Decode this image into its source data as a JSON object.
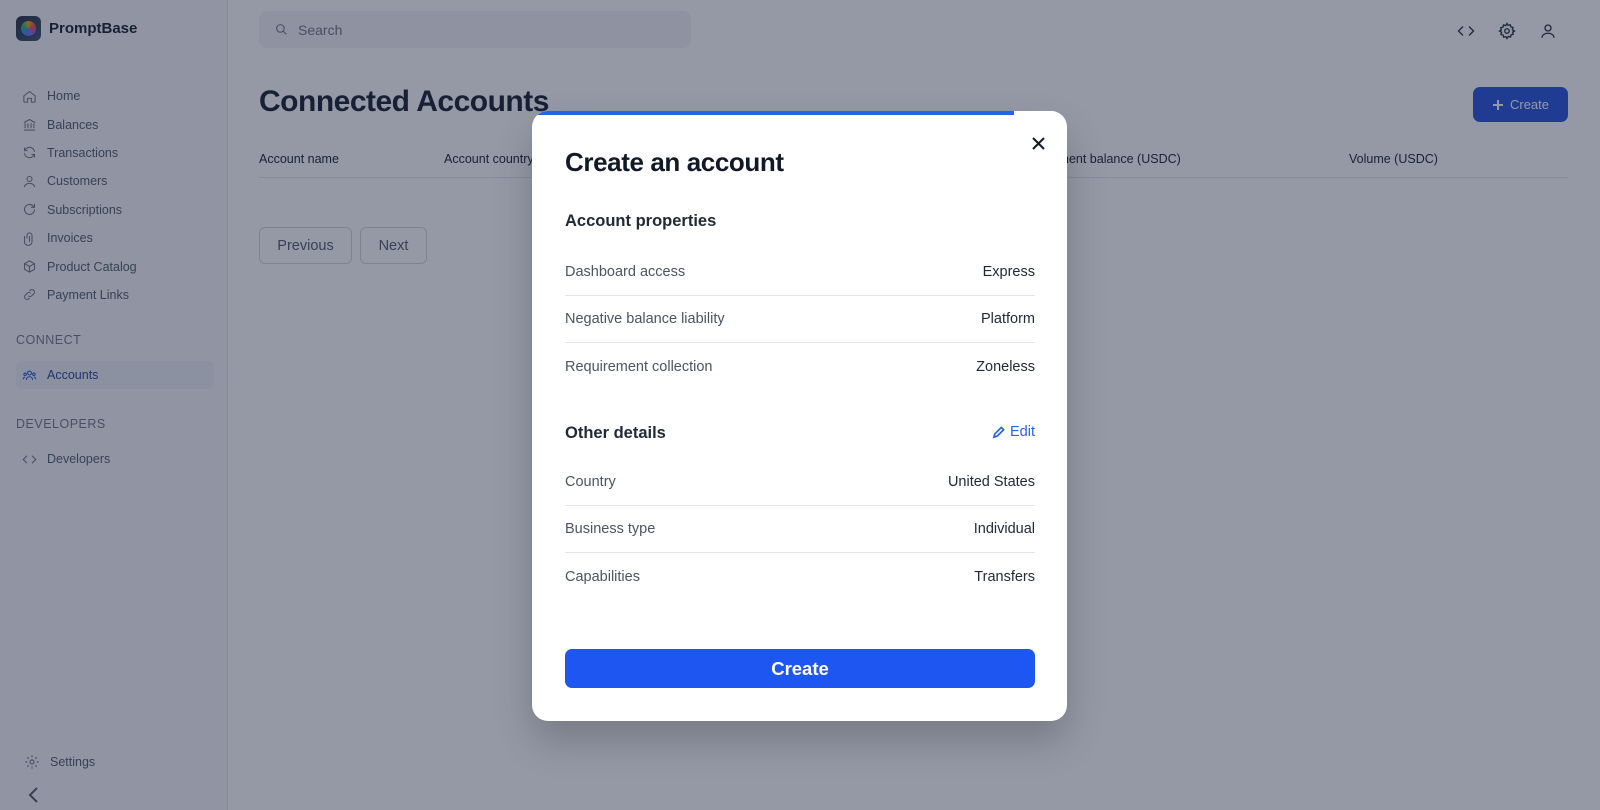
{
  "app": {
    "name": "PromptBase"
  },
  "sidebar": {
    "items": [
      {
        "label": "Home",
        "icon": "home-icon"
      },
      {
        "label": "Balances",
        "icon": "bank-icon"
      },
      {
        "label": "Transactions",
        "icon": "refresh-icon"
      },
      {
        "label": "Customers",
        "icon": "user-icon"
      },
      {
        "label": "Subscriptions",
        "icon": "rotate-icon"
      },
      {
        "label": "Invoices",
        "icon": "paperclip-icon"
      },
      {
        "label": "Product Catalog",
        "icon": "box-icon"
      },
      {
        "label": "Payment Links",
        "icon": "link-icon"
      }
    ],
    "connect_label": "CONNECT",
    "accounts_label": "Accounts",
    "developers_section": "DEVELOPERS",
    "developers_label": "Developers",
    "settings_label": "Settings"
  },
  "search": {
    "placeholder": "Search"
  },
  "page": {
    "title": "Connected Accounts",
    "create_label": "Create",
    "columns": [
      "Account name",
      "Account country",
      "",
      "Payment balance (USDC)",
      "Volume (USDC)"
    ],
    "col_account_name": "Account name",
    "col_account_country": "Account country",
    "col_payment_balance": "Payment balance (USDC)",
    "col_volume": "Volume (USDC)",
    "previous_label": "Previous",
    "next_label": "Next"
  },
  "modal": {
    "title": "Create an account",
    "progress": 0.9,
    "account_properties_title": "Account properties",
    "account_properties": [
      {
        "label": "Dashboard access",
        "value": "Express"
      },
      {
        "label": "Negative balance liability",
        "value": "Platform"
      },
      {
        "label": "Requirement collection",
        "value": "Zoneless"
      }
    ],
    "other_details_title": "Other details",
    "edit_label": "Edit",
    "other_details": [
      {
        "label": "Country",
        "value": "United States"
      },
      {
        "label": "Business type",
        "value": "Individual"
      },
      {
        "label": "Capabilities",
        "value": "Transfers"
      }
    ],
    "create_label": "Create"
  },
  "colors": {
    "accent": "#1d56f0",
    "progress": "#2563eb",
    "overlay": "rgba(33,42,68,0.48)"
  }
}
